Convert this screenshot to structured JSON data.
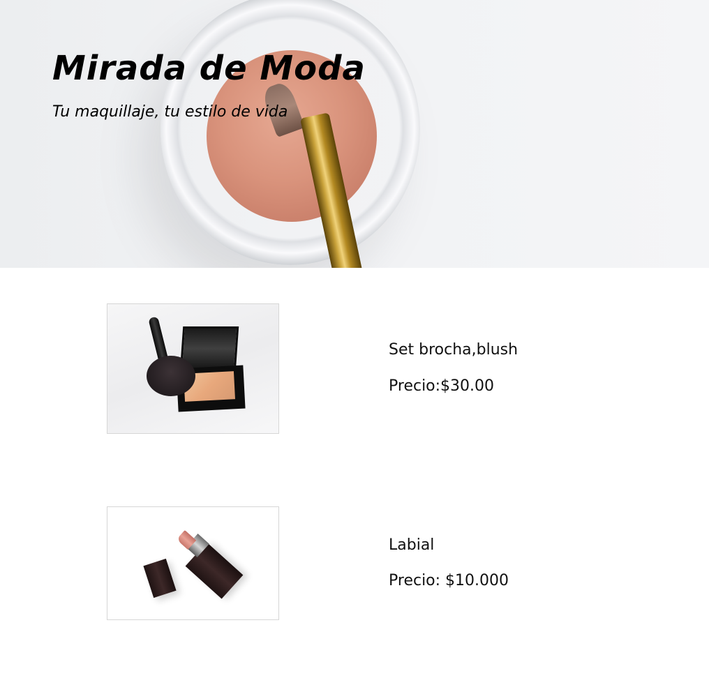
{
  "hero": {
    "title": "Mirada de Moda",
    "subtitle": "Tu maquillaje, tu estilo de vida"
  },
  "products": [
    {
      "name": "Set brocha,blush",
      "price": "Precio:$30.00",
      "image_desc": "makeup brush with compact mirror"
    },
    {
      "name": "Labial",
      "price": "Precio: $10.000",
      "image_desc": "lipstick"
    }
  ]
}
